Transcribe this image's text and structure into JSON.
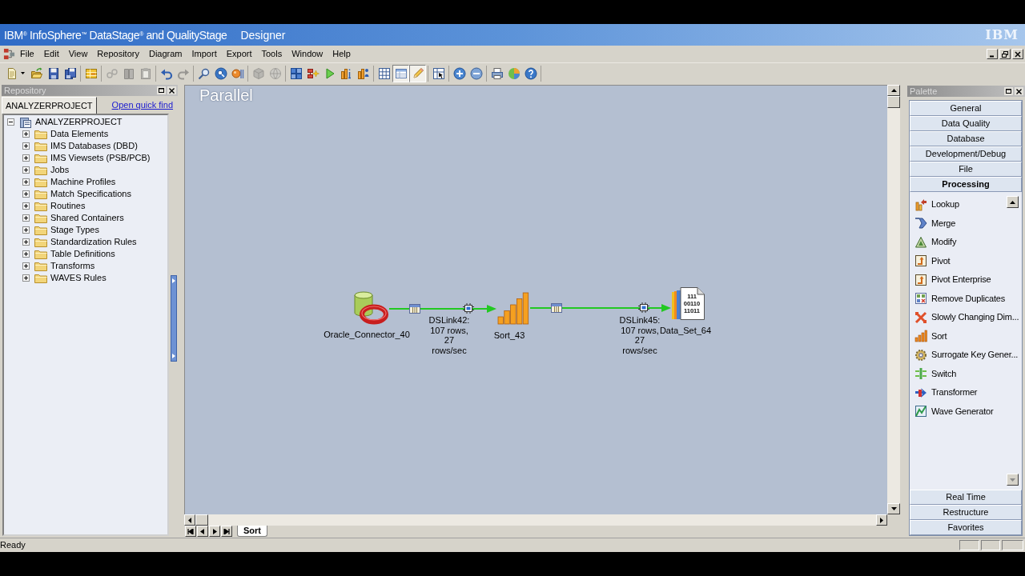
{
  "window": {
    "title": "IBM$^{®}$ InfoSphere$^{™}$ DataStage$^{®}$ and QualityStage",
    "subtitle": "Designer",
    "logo": "IBM"
  },
  "menu": [
    "File",
    "Edit",
    "View",
    "Repository",
    "Diagram",
    "Import",
    "Export",
    "Tools",
    "Window",
    "Help"
  ],
  "toolbar": [
    {
      "kind": "dropdown-button",
      "pressed": false,
      "disabled": false
    },
    {
      "kind": "button",
      "pressed": false,
      "disabled": false
    },
    {
      "kind": "button",
      "pressed": false,
      "disabled": false
    },
    {
      "kind": "button",
      "pressed": false,
      "disabled": false
    },
    {
      "kind": "separator"
    },
    {
      "kind": "button",
      "pressed": false,
      "disabled": false
    },
    {
      "kind": "separator"
    },
    {
      "kind": "button",
      "pressed": false,
      "disabled": true
    },
    {
      "kind": "button",
      "pressed": false,
      "disabled": true
    },
    {
      "kind": "button",
      "pressed": false,
      "disabled": true
    },
    {
      "kind": "separator"
    },
    {
      "kind": "button",
      "pressed": false,
      "disabled": false
    },
    {
      "kind": "button",
      "pressed": false,
      "disabled": true
    },
    {
      "kind": "separator"
    },
    {
      "kind": "button",
      "pressed": false,
      "disabled": false
    },
    {
      "kind": "button",
      "pressed": false,
      "disabled": false
    },
    {
      "kind": "button",
      "pressed": false,
      "disabled": false
    },
    {
      "kind": "separator"
    },
    {
      "kind": "button",
      "pressed": false,
      "disabled": true
    },
    {
      "kind": "button",
      "pressed": false,
      "disabled": true
    },
    {
      "kind": "separator"
    },
    {
      "kind": "button",
      "pressed": false,
      "disabled": false
    },
    {
      "kind": "button",
      "pressed": false,
      "disabled": false
    },
    {
      "kind": "button",
      "pressed": false,
      "disabled": false
    },
    {
      "kind": "button",
      "pressed": false,
      "disabled": false
    },
    {
      "kind": "button",
      "pressed": false,
      "disabled": false
    },
    {
      "kind": "separator"
    },
    {
      "kind": "button",
      "pressed": false,
      "disabled": false
    },
    {
      "kind": "button",
      "pressed": true,
      "disabled": false
    },
    {
      "kind": "button",
      "pressed": true,
      "disabled": false
    },
    {
      "kind": "separator"
    },
    {
      "kind": "button",
      "pressed": false,
      "disabled": false
    },
    {
      "kind": "separator"
    },
    {
      "kind": "button",
      "pressed": false,
      "disabled": false
    },
    {
      "kind": "button",
      "pressed": false,
      "disabled": false
    },
    {
      "kind": "separator"
    },
    {
      "kind": "button",
      "pressed": false,
      "disabled": false
    },
    {
      "kind": "button",
      "pressed": false,
      "disabled": false
    },
    {
      "kind": "button",
      "pressed": false,
      "disabled": false
    },
    {
      "kind": "separator"
    }
  ],
  "repository": {
    "title": "Repository",
    "tabs": [
      {
        "label": "ANALYZERPROJECT",
        "selected": true
      }
    ],
    "quick_find_link": "Open quick find",
    "tree": [
      {
        "label": "ANALYZERPROJECT",
        "expanded": true,
        "children": [
          {
            "label": "Data Elements",
            "expanded": false
          },
          {
            "label": "IMS Databases (DBD)",
            "expanded": false
          },
          {
            "label": "IMS Viewsets (PSB/PCB)",
            "expanded": false
          },
          {
            "label": "Jobs",
            "expanded": false
          },
          {
            "label": "Machine Profiles",
            "expanded": false
          },
          {
            "label": "Match Specifications",
            "expanded": false
          },
          {
            "label": "Routines",
            "expanded": false
          },
          {
            "label": "Shared Containers",
            "expanded": false
          },
          {
            "label": "Stage Types",
            "expanded": false
          },
          {
            "label": "Standardization Rules",
            "expanded": false
          },
          {
            "label": "Table Definitions",
            "expanded": false
          },
          {
            "label": "Transforms",
            "expanded": false
          },
          {
            "label": "WAVES Rules",
            "expanded": false
          }
        ]
      }
    ]
  },
  "canvas": {
    "job_type_label": "Parallel",
    "nodes": [
      {
        "kind": "oracle",
        "label": "Oracle_Connector_40"
      },
      {
        "kind": "sort",
        "label": "Sort_43"
      },
      {
        "kind": "dataset",
        "label": "Data_Set_64",
        "icon_text": [
          "111",
          "00110",
          "11011"
        ]
      }
    ],
    "links": [
      {
        "label": "DSLink42:\n107 rows,\n27\nrows/sec"
      },
      {
        "label": "DSLink45:\n107 rows,\n27\nrows/sec"
      }
    ],
    "job_tabs": [
      {
        "label": "Sort",
        "selected": true
      }
    ]
  },
  "palette": {
    "title": "Palette",
    "drawers": [
      {
        "label": "General",
        "selected": false
      },
      {
        "label": "Data Quality",
        "selected": false
      },
      {
        "label": "Database",
        "selected": false
      },
      {
        "label": "Development/Debug",
        "selected": false
      },
      {
        "label": "File",
        "selected": false
      },
      {
        "label": "Processing",
        "selected": true
      }
    ],
    "items": [
      "Lookup",
      "Merge",
      "Modify",
      "Pivot",
      "Pivot Enterprise",
      "Remove Duplicates",
      "Slowly Changing Dim...",
      "Sort",
      "Surrogate Key Gener...",
      "Switch",
      "Transformer",
      "Wave Generator"
    ],
    "drawers_below": [
      {
        "label": "Real Time",
        "selected": false
      },
      {
        "label": "Restructure",
        "selected": false
      },
      {
        "label": "Favorites",
        "selected": false
      }
    ]
  },
  "status_bar": {
    "text": "Ready"
  }
}
